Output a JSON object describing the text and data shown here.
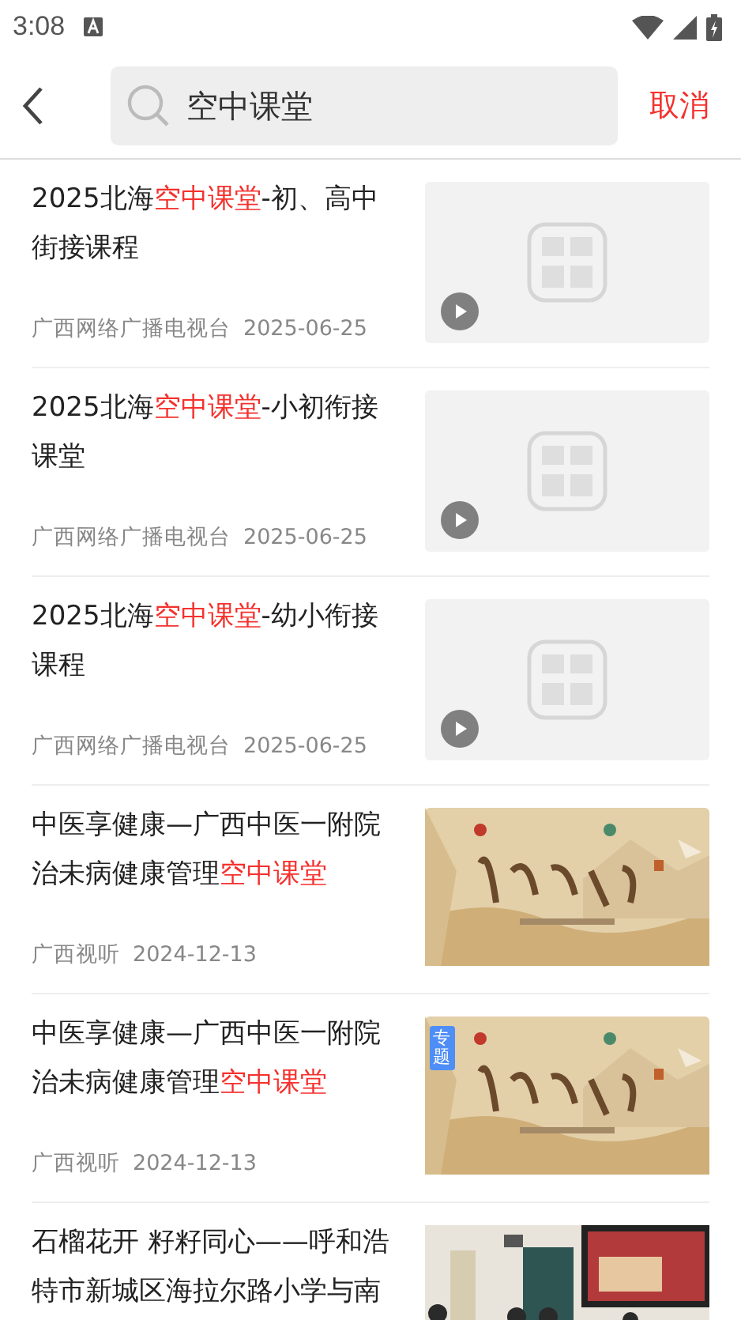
{
  "status_bar": {
    "time": "3:08"
  },
  "search": {
    "value": "空中课堂",
    "cancel": "取消"
  },
  "results": [
    {
      "title": [
        {
          "text": "2025北海",
          "highlight": false
        },
        {
          "text": "空中课堂",
          "highlight": true
        },
        {
          "text": "-初、高中街接课程",
          "highlight": false
        }
      ],
      "source": "广西网络广播电视台",
      "date": "2025-06-25",
      "thumb": {
        "kind": "placeholder",
        "video": true
      }
    },
    {
      "title": [
        {
          "text": "2025北海",
          "highlight": false
        },
        {
          "text": "空中课堂",
          "highlight": true
        },
        {
          "text": "-小初衔接课堂",
          "highlight": false
        }
      ],
      "source": "广西网络广播电视台",
      "date": "2025-06-25",
      "thumb": {
        "kind": "placeholder",
        "video": true
      }
    },
    {
      "title": [
        {
          "text": "2025北海",
          "highlight": false
        },
        {
          "text": "空中课堂",
          "highlight": true
        },
        {
          "text": "-幼小衔接课程",
          "highlight": false
        }
      ],
      "source": "广西网络广播电视台",
      "date": "2025-06-25",
      "thumb": {
        "kind": "placeholder",
        "video": true
      }
    },
    {
      "title": [
        {
          "text": "中医享健康—广西中医一附院治未病健康管理",
          "highlight": false
        },
        {
          "text": "空中课堂",
          "highlight": true
        }
      ],
      "source": "广西视听",
      "date": "2024-12-13",
      "thumb": {
        "kind": "painting",
        "video": false
      }
    },
    {
      "title": [
        {
          "text": "中医享健康—广西中医一附院治未病健康管理",
          "highlight": false
        },
        {
          "text": "空中课堂",
          "highlight": true
        }
      ],
      "source": "广西视听",
      "date": "2024-12-13",
      "thumb": {
        "kind": "painting",
        "video": false,
        "badge": "专题"
      }
    },
    {
      "title": [
        {
          "text": "石榴花开  籽籽同心——呼和浩特市新城区海拉尔路小学与南",
          "highlight": false
        }
      ],
      "thumb": {
        "kind": "classroom",
        "video": false
      }
    }
  ]
}
